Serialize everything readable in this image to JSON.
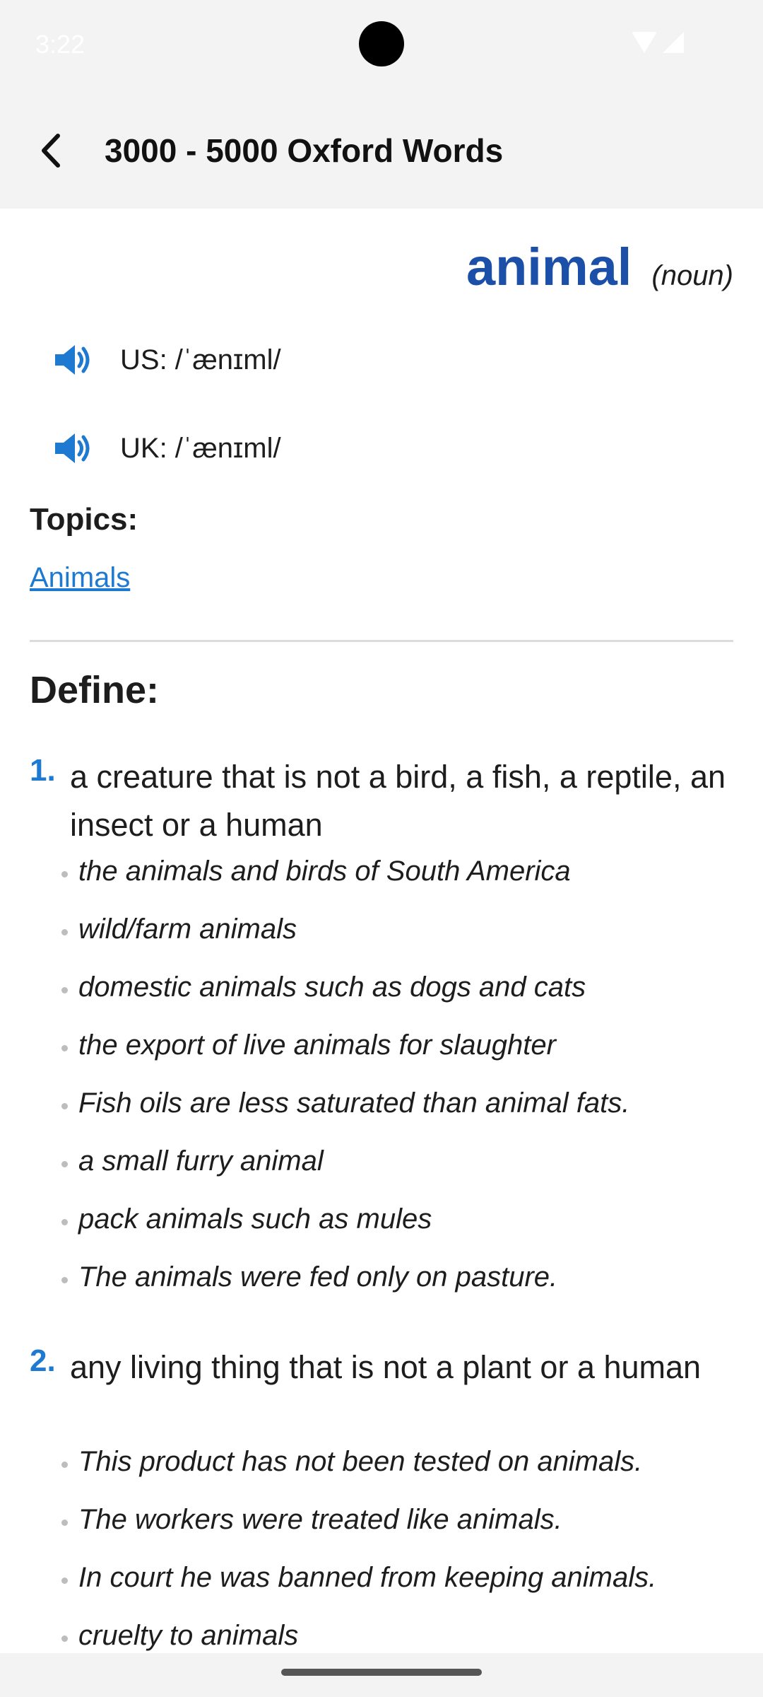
{
  "status_bar": {
    "time": "3:22"
  },
  "app_bar": {
    "title": "3000 - 5000 Oxford Words"
  },
  "entry": {
    "word": "animal",
    "part_of_speech": "(noun)",
    "pronunciations": [
      {
        "label": "US: /ˈænɪml/"
      },
      {
        "label": "UK: /ˈænɪml/"
      }
    ],
    "topics_label": "Topics:",
    "topics": [
      "Animals"
    ],
    "define_label": "Define:",
    "senses": [
      {
        "number": "1.",
        "definition": "a creature that is not a bird, a fish, a reptile, an insect or a human",
        "examples": [
          "the animals and birds of South America",
          "wild/farm animals",
          "domestic animals such as dogs and cats",
          "the export of live animals for slaughter",
          "Fish oils are less saturated than animal fats.",
          "a small furry animal",
          "pack animals such as mules",
          "The animals were fed only on pasture."
        ]
      },
      {
        "number": "2.",
        "definition": "any living thing that is not a plant or a human",
        "examples": [
          "This product has not been tested on animals.",
          "The workers were treated like animals.",
          "In court he was banned from keeping animals.",
          "cruelty to animals"
        ]
      }
    ]
  },
  "colors": {
    "accent": "#1e7ad0",
    "word": "#1b4fa8"
  }
}
